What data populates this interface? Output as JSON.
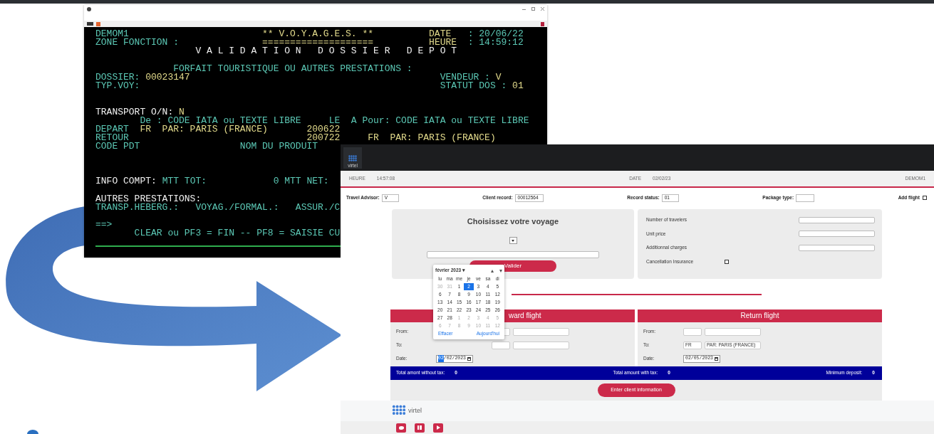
{
  "terminal_window": {
    "lines": [
      {
        "segments": [
          {
            "text": "DEMOM1",
            "kind": "label"
          },
          {
            "text": "** V.O.Y.A.G.E.S. **",
            "kind": "value"
          },
          {
            "text": "DATE",
            "kind": "value"
          },
          {
            "text": ": 20/06/22",
            "kind": "label"
          }
        ]
      },
      {
        "segments": [
          {
            "text": "ZONE FONCTION :",
            "kind": "label"
          },
          {
            "text": "====================",
            "kind": "value"
          },
          {
            "text": "HEURE",
            "kind": "value"
          },
          {
            "text": ": 14:59:12",
            "kind": "label"
          }
        ]
      },
      {
        "segments": [
          {
            "text": "V A L I D A T I O N   D O S S I E R   D E P O T",
            "kind": "heading"
          }
        ]
      },
      {
        "segments": [
          {
            "text": "FORFAIT TOURISTIQUE OU AUTRES PRESTATIONS :",
            "kind": "label"
          }
        ]
      },
      {
        "segments": [
          {
            "text": "DOSSIER:",
            "kind": "label"
          },
          {
            "text": "00023147",
            "kind": "value"
          },
          {
            "text": "VENDEUR :",
            "kind": "label"
          },
          {
            "text": "V",
            "kind": "value"
          }
        ]
      },
      {
        "segments": [
          {
            "text": "TYP.VOY:",
            "kind": "label"
          },
          {
            "text": "STATUT DOS :",
            "kind": "label"
          },
          {
            "text": "01",
            "kind": "value"
          }
        ]
      },
      {
        "segments": [
          {
            "text": "TRANSPORT O/N:",
            "kind": "heading"
          },
          {
            "text": "N",
            "kind": "value"
          }
        ]
      },
      {
        "segments": [
          {
            "text": "De : CODE IATA ou TEXTE LIBRE",
            "kind": "label"
          },
          {
            "text": "LE",
            "kind": "label"
          },
          {
            "text": "A",
            "kind": "label"
          },
          {
            "text": "Pour: CODE IATA ou TEXTE LIBRE",
            "kind": "label"
          }
        ]
      },
      {
        "segments": [
          {
            "text": "DEPART",
            "kind": "label"
          },
          {
            "text": "FR",
            "kind": "value"
          },
          {
            "text": "PAR: PARIS (FRANCE)",
            "kind": "value"
          },
          {
            "text": "200622",
            "kind": "value"
          }
        ]
      },
      {
        "segments": [
          {
            "text": "RETOUR",
            "kind": "label"
          },
          {
            "text": "200722",
            "kind": "value"
          },
          {
            "text": "FR",
            "kind": "value"
          },
          {
            "text": "PAR: PARIS (FRANCE)",
            "kind": "value"
          }
        ]
      },
      {
        "segments": [
          {
            "text": "CODE PDT",
            "kind": "label"
          },
          {
            "text": "NOM DU PRODUIT",
            "kind": "label"
          }
        ]
      },
      {
        "segments": [
          {
            "text": "INFO COMPT:",
            "kind": "heading"
          },
          {
            "text": "MTT TOT:",
            "kind": "label"
          },
          {
            "text": "0 MTT NET:",
            "kind": "label"
          }
        ]
      },
      {
        "segments": [
          {
            "text": "AUTRES PRESTATIONS:",
            "kind": "heading"
          }
        ]
      },
      {
        "segments": [
          {
            "text": "TRANSP.HEBERG.:",
            "kind": "label"
          },
          {
            "text": "VOYAG./FORMAL.:",
            "kind": "label"
          },
          {
            "text": "ASSUR./C",
            "kind": "label"
          }
        ]
      },
      {
        "segments": [
          {
            "text": "==>",
            "kind": "label"
          }
        ]
      },
      {
        "segments": [
          {
            "text": "CLEAR ou PF3 = FIN -- PF8 = SAISIE CU",
            "kind": "label"
          }
        ]
      }
    ]
  },
  "web_app": {
    "logo_text": "virtel",
    "info_bar": {
      "time_label": "HEURE",
      "time": "14:57:08",
      "date_label": "DATE",
      "date": "02/02/23",
      "user": "DEMOM1"
    },
    "record_fields": [
      {
        "label": "Travel Advisor:",
        "value": "V"
      },
      {
        "label": "Client record:",
        "value": "00012564"
      },
      {
        "label": "Record status:",
        "value": "01"
      },
      {
        "label": "Package type:"
      }
    ],
    "add_flight": {
      "label": "Add flight",
      "checked": false
    },
    "voyage_panel": {
      "title": "Choisissez votre voyage",
      "button": "Valider"
    },
    "pricing": [
      {
        "label": "Number of travelers",
        "kind": "number"
      },
      {
        "label": "Unit price",
        "kind": "number"
      },
      {
        "label": "Additionnal charges",
        "kind": "number"
      },
      {
        "label": "Cancellation Insurance",
        "kind": "checkbox",
        "checked": false
      }
    ],
    "flights": [
      {
        "title": "ward flight",
        "rows": [
          {
            "label": "From:",
            "kind": "route"
          },
          {
            "label": "To:",
            "kind": "route"
          },
          {
            "label": "Date:",
            "kind": "date",
            "date": {
              "day": "02",
              "rest": "/02/2023",
              "focused": true
            }
          }
        ]
      },
      {
        "title": "Return flight",
        "rows": [
          {
            "label": "From:",
            "kind": "route"
          },
          {
            "label": "To:",
            "kind": "route",
            "code": "FR",
            "place": "PAR: PARIS (FRANCE)"
          },
          {
            "label": "Date:",
            "kind": "date",
            "date": {
              "day": "02",
              "rest": "/05/2023",
              "focused": false
            }
          }
        ]
      }
    ],
    "totals": [
      {
        "label": "Total amont without tax:",
        "value": "0"
      },
      {
        "label": "Total amount with tax:",
        "value": "0"
      },
      {
        "label": "Minimum deposit:",
        "value": "0"
      }
    ],
    "submit_button": "Enter client information",
    "footer": {
      "logo_text": "virtel"
    },
    "date_picker": {
      "month": "février 2023 ▾",
      "weekdays": [
        "lu",
        "ma",
        "me",
        "je",
        "ve",
        "sa",
        "di"
      ],
      "days": [
        {
          "day": "30",
          "outside": true,
          "selected": false
        },
        {
          "day": "31",
          "outside": true,
          "selected": false
        },
        {
          "day": "1",
          "outside": false,
          "selected": false
        },
        {
          "day": "2",
          "outside": false,
          "selected": true
        },
        {
          "day": "3",
          "outside": false,
          "selected": false
        },
        {
          "day": "4",
          "outside": false,
          "selected": false
        },
        {
          "day": "5",
          "outside": false,
          "selected": false
        },
        {
          "day": "6",
          "outside": false,
          "selected": false
        },
        {
          "day": "7",
          "outside": false,
          "selected": false
        },
        {
          "day": "8",
          "outside": false,
          "selected": false
        },
        {
          "day": "9",
          "outside": false,
          "selected": false
        },
        {
          "day": "10",
          "outside": false,
          "selected": false
        },
        {
          "day": "11",
          "outside": false,
          "selected": false
        },
        {
          "day": "12",
          "outside": false,
          "selected": false
        },
        {
          "day": "13",
          "outside": false,
          "selected": false
        },
        {
          "day": "14",
          "outside": false,
          "selected": false
        },
        {
          "day": "15",
          "outside": false,
          "selected": false
        },
        {
          "day": "16",
          "outside": false,
          "selected": false
        },
        {
          "day": "17",
          "outside": false,
          "selected": false
        },
        {
          "day": "18",
          "outside": false,
          "selected": false
        },
        {
          "day": "19",
          "outside": false,
          "selected": false
        },
        {
          "day": "20",
          "outside": false,
          "selected": false
        },
        {
          "day": "21",
          "outside": false,
          "selected": false
        },
        {
          "day": "22",
          "outside": false,
          "selected": false
        },
        {
          "day": "23",
          "outside": false,
          "selected": false
        },
        {
          "day": "24",
          "outside": false,
          "selected": false
        },
        {
          "day": "25",
          "outside": false,
          "selected": false
        },
        {
          "day": "26",
          "outside": false,
          "selected": false
        },
        {
          "day": "27",
          "outside": false,
          "selected": false
        },
        {
          "day": "28",
          "outside": false,
          "selected": false
        },
        {
          "day": "1",
          "outside": true,
          "selected": false
        },
        {
          "day": "2",
          "outside": true,
          "selected": false
        },
        {
          "day": "3",
          "outside": true,
          "selected": false
        },
        {
          "day": "4",
          "outside": true,
          "selected": false
        },
        {
          "day": "5",
          "outside": true,
          "selected": false
        },
        {
          "day": "6",
          "outside": true,
          "selected": false
        },
        {
          "day": "7",
          "outside": true,
          "selected": false
        },
        {
          "day": "8",
          "outside": true,
          "selected": false
        },
        {
          "day": "9",
          "outside": true,
          "selected": false
        },
        {
          "day": "10",
          "outside": true,
          "selected": false
        },
        {
          "day": "11",
          "outside": true,
          "selected": false
        },
        {
          "day": "12",
          "outside": true,
          "selected": false
        }
      ],
      "clear": "Effacer",
      "today": "Aujourd'hui"
    }
  }
}
